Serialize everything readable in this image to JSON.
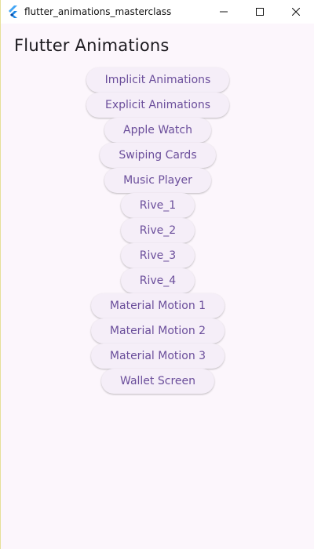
{
  "window": {
    "title": "flutter_animations_masterclass"
  },
  "page": {
    "heading": "Flutter Animations"
  },
  "buttons": [
    {
      "label": "Implicit Animations"
    },
    {
      "label": "Explicit Animations"
    },
    {
      "label": "Apple Watch"
    },
    {
      "label": "Swiping Cards"
    },
    {
      "label": "Music Player"
    },
    {
      "label": "Rive_1"
    },
    {
      "label": "Rive_2"
    },
    {
      "label": "Rive_3"
    },
    {
      "label": "Rive_4"
    },
    {
      "label": "Material Motion 1"
    },
    {
      "label": "Material Motion 2"
    },
    {
      "label": "Material Motion 3"
    },
    {
      "label": "Wallet Screen"
    }
  ],
  "colors": {
    "background": "#fcf6fc",
    "button_bg": "#f5eef8",
    "button_text": "#6b4e9b",
    "heading_text": "#1d1b20"
  },
  "icons": {
    "app": "flutter-logo-icon",
    "minimize": "minimize-icon",
    "maximize": "maximize-icon",
    "close": "close-icon"
  }
}
